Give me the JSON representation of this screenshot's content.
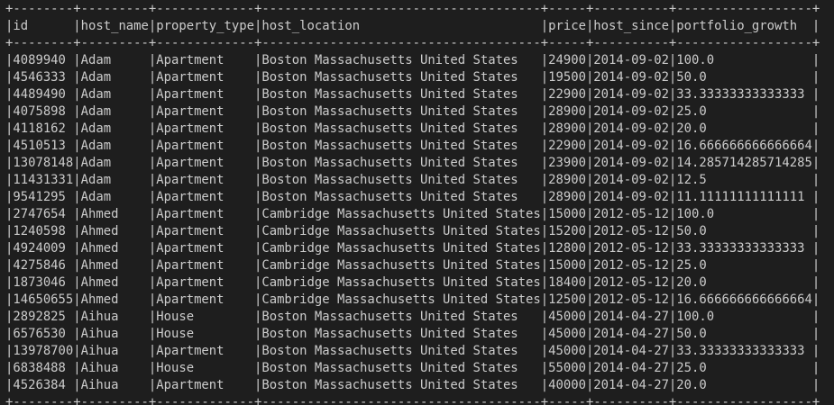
{
  "table": {
    "columns": [
      "id",
      "host_name",
      "property_type",
      "host_location",
      "price",
      "host_since",
      "portfolio_growth"
    ],
    "rows": [
      [
        "4089940",
        "Adam",
        "Apartment",
        "Boston Massachusetts United States",
        "24900",
        "2014-09-02",
        "100.0"
      ],
      [
        "4546333",
        "Adam",
        "Apartment",
        "Boston Massachusetts United States",
        "19500",
        "2014-09-02",
        "50.0"
      ],
      [
        "4489490",
        "Adam",
        "Apartment",
        "Boston Massachusetts United States",
        "22900",
        "2014-09-02",
        "33.33333333333333"
      ],
      [
        "4075898",
        "Adam",
        "Apartment",
        "Boston Massachusetts United States",
        "28900",
        "2014-09-02",
        "25.0"
      ],
      [
        "4118162",
        "Adam",
        "Apartment",
        "Boston Massachusetts United States",
        "28900",
        "2014-09-02",
        "20.0"
      ],
      [
        "4510513",
        "Adam",
        "Apartment",
        "Boston Massachusetts United States",
        "22900",
        "2014-09-02",
        "16.666666666666664"
      ],
      [
        "13078148",
        "Adam",
        "Apartment",
        "Boston Massachusetts United States",
        "23900",
        "2014-09-02",
        "14.285714285714285"
      ],
      [
        "11431331",
        "Adam",
        "Apartment",
        "Boston Massachusetts United States",
        "28900",
        "2014-09-02",
        "12.5"
      ],
      [
        "9541295",
        "Adam",
        "Apartment",
        "Boston Massachusetts United States",
        "28900",
        "2014-09-02",
        "11.11111111111111"
      ],
      [
        "2747654",
        "Ahmed",
        "Apartment",
        "Cambridge Massachusetts United States",
        "15000",
        "2012-05-12",
        "100.0"
      ],
      [
        "1240598",
        "Ahmed",
        "Apartment",
        "Cambridge Massachusetts United States",
        "15200",
        "2012-05-12",
        "50.0"
      ],
      [
        "4924009",
        "Ahmed",
        "Apartment",
        "Cambridge Massachusetts United States",
        "12800",
        "2012-05-12",
        "33.33333333333333"
      ],
      [
        "4275846",
        "Ahmed",
        "Apartment",
        "Cambridge Massachusetts United States",
        "15000",
        "2012-05-12",
        "25.0"
      ],
      [
        "1873046",
        "Ahmed",
        "Apartment",
        "Cambridge Massachusetts United States",
        "18400",
        "2012-05-12",
        "20.0"
      ],
      [
        "14650655",
        "Ahmed",
        "Apartment",
        "Cambridge Massachusetts United States",
        "12500",
        "2012-05-12",
        "16.666666666666664"
      ],
      [
        "2892825",
        "Aihua",
        "House",
        "Boston Massachusetts United States",
        "45000",
        "2014-04-27",
        "100.0"
      ],
      [
        "6576530",
        "Aihua",
        "House",
        "Boston Massachusetts United States",
        "45000",
        "2014-04-27",
        "50.0"
      ],
      [
        "13978700",
        "Aihua",
        "Apartment",
        "Boston Massachusetts United States",
        "45000",
        "2014-04-27",
        "33.33333333333333"
      ],
      [
        "6838488",
        "Aihua",
        "House",
        "Boston Massachusetts United States",
        "55000",
        "2014-04-27",
        "25.0"
      ],
      [
        "4526384",
        "Aihua",
        "Apartment",
        "Boston Massachusetts United States",
        "40000",
        "2014-04-27",
        "20.0"
      ]
    ]
  }
}
